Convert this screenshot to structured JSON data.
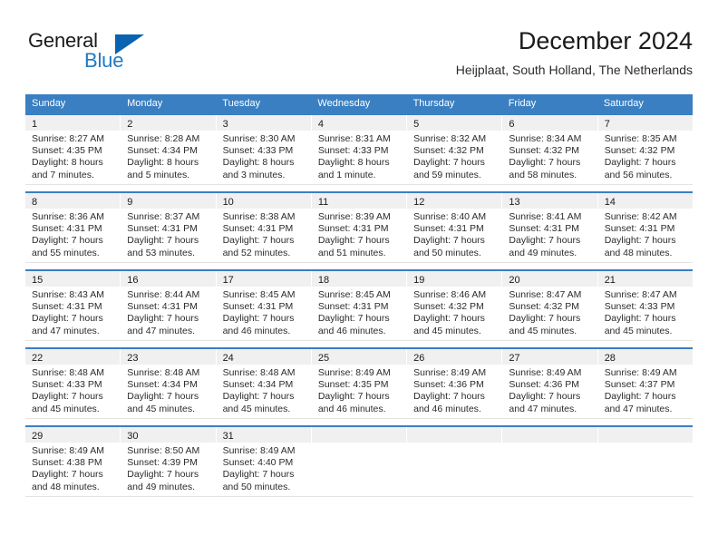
{
  "brand": {
    "name_part1": "General",
    "name_part2": "Blue",
    "triangle_color": "#0a63b0",
    "blue_text_color": "#1f7ac4"
  },
  "header": {
    "title": "December 2024",
    "subtitle": "Heijplaat, South Holland, The Netherlands"
  },
  "theme": {
    "header_blue": "#3a7fc1",
    "daynum_band": "#f0f0f0",
    "cell_text": "#2b2b2b"
  },
  "weekday_headers": [
    "Sunday",
    "Monday",
    "Tuesday",
    "Wednesday",
    "Thursday",
    "Friday",
    "Saturday"
  ],
  "weeks": [
    {
      "days": [
        {
          "num": "1",
          "sunrise": "Sunrise: 8:27 AM",
          "sunset": "Sunset: 4:35 PM",
          "daylight1": "Daylight: 8 hours",
          "daylight2": "and 7 minutes."
        },
        {
          "num": "2",
          "sunrise": "Sunrise: 8:28 AM",
          "sunset": "Sunset: 4:34 PM",
          "daylight1": "Daylight: 8 hours",
          "daylight2": "and 5 minutes."
        },
        {
          "num": "3",
          "sunrise": "Sunrise: 8:30 AM",
          "sunset": "Sunset: 4:33 PM",
          "daylight1": "Daylight: 8 hours",
          "daylight2": "and 3 minutes."
        },
        {
          "num": "4",
          "sunrise": "Sunrise: 8:31 AM",
          "sunset": "Sunset: 4:33 PM",
          "daylight1": "Daylight: 8 hours",
          "daylight2": "and 1 minute."
        },
        {
          "num": "5",
          "sunrise": "Sunrise: 8:32 AM",
          "sunset": "Sunset: 4:32 PM",
          "daylight1": "Daylight: 7 hours",
          "daylight2": "and 59 minutes."
        },
        {
          "num": "6",
          "sunrise": "Sunrise: 8:34 AM",
          "sunset": "Sunset: 4:32 PM",
          "daylight1": "Daylight: 7 hours",
          "daylight2": "and 58 minutes."
        },
        {
          "num": "7",
          "sunrise": "Sunrise: 8:35 AM",
          "sunset": "Sunset: 4:32 PM",
          "daylight1": "Daylight: 7 hours",
          "daylight2": "and 56 minutes."
        }
      ]
    },
    {
      "days": [
        {
          "num": "8",
          "sunrise": "Sunrise: 8:36 AM",
          "sunset": "Sunset: 4:31 PM",
          "daylight1": "Daylight: 7 hours",
          "daylight2": "and 55 minutes."
        },
        {
          "num": "9",
          "sunrise": "Sunrise: 8:37 AM",
          "sunset": "Sunset: 4:31 PM",
          "daylight1": "Daylight: 7 hours",
          "daylight2": "and 53 minutes."
        },
        {
          "num": "10",
          "sunrise": "Sunrise: 8:38 AM",
          "sunset": "Sunset: 4:31 PM",
          "daylight1": "Daylight: 7 hours",
          "daylight2": "and 52 minutes."
        },
        {
          "num": "11",
          "sunrise": "Sunrise: 8:39 AM",
          "sunset": "Sunset: 4:31 PM",
          "daylight1": "Daylight: 7 hours",
          "daylight2": "and 51 minutes."
        },
        {
          "num": "12",
          "sunrise": "Sunrise: 8:40 AM",
          "sunset": "Sunset: 4:31 PM",
          "daylight1": "Daylight: 7 hours",
          "daylight2": "and 50 minutes."
        },
        {
          "num": "13",
          "sunrise": "Sunrise: 8:41 AM",
          "sunset": "Sunset: 4:31 PM",
          "daylight1": "Daylight: 7 hours",
          "daylight2": "and 49 minutes."
        },
        {
          "num": "14",
          "sunrise": "Sunrise: 8:42 AM",
          "sunset": "Sunset: 4:31 PM",
          "daylight1": "Daylight: 7 hours",
          "daylight2": "and 48 minutes."
        }
      ]
    },
    {
      "days": [
        {
          "num": "15",
          "sunrise": "Sunrise: 8:43 AM",
          "sunset": "Sunset: 4:31 PM",
          "daylight1": "Daylight: 7 hours",
          "daylight2": "and 47 minutes."
        },
        {
          "num": "16",
          "sunrise": "Sunrise: 8:44 AM",
          "sunset": "Sunset: 4:31 PM",
          "daylight1": "Daylight: 7 hours",
          "daylight2": "and 47 minutes."
        },
        {
          "num": "17",
          "sunrise": "Sunrise: 8:45 AM",
          "sunset": "Sunset: 4:31 PM",
          "daylight1": "Daylight: 7 hours",
          "daylight2": "and 46 minutes."
        },
        {
          "num": "18",
          "sunrise": "Sunrise: 8:45 AM",
          "sunset": "Sunset: 4:31 PM",
          "daylight1": "Daylight: 7 hours",
          "daylight2": "and 46 minutes."
        },
        {
          "num": "19",
          "sunrise": "Sunrise: 8:46 AM",
          "sunset": "Sunset: 4:32 PM",
          "daylight1": "Daylight: 7 hours",
          "daylight2": "and 45 minutes."
        },
        {
          "num": "20",
          "sunrise": "Sunrise: 8:47 AM",
          "sunset": "Sunset: 4:32 PM",
          "daylight1": "Daylight: 7 hours",
          "daylight2": "and 45 minutes."
        },
        {
          "num": "21",
          "sunrise": "Sunrise: 8:47 AM",
          "sunset": "Sunset: 4:33 PM",
          "daylight1": "Daylight: 7 hours",
          "daylight2": "and 45 minutes."
        }
      ]
    },
    {
      "days": [
        {
          "num": "22",
          "sunrise": "Sunrise: 8:48 AM",
          "sunset": "Sunset: 4:33 PM",
          "daylight1": "Daylight: 7 hours",
          "daylight2": "and 45 minutes."
        },
        {
          "num": "23",
          "sunrise": "Sunrise: 8:48 AM",
          "sunset": "Sunset: 4:34 PM",
          "daylight1": "Daylight: 7 hours",
          "daylight2": "and 45 minutes."
        },
        {
          "num": "24",
          "sunrise": "Sunrise: 8:48 AM",
          "sunset": "Sunset: 4:34 PM",
          "daylight1": "Daylight: 7 hours",
          "daylight2": "and 45 minutes."
        },
        {
          "num": "25",
          "sunrise": "Sunrise: 8:49 AM",
          "sunset": "Sunset: 4:35 PM",
          "daylight1": "Daylight: 7 hours",
          "daylight2": "and 46 minutes."
        },
        {
          "num": "26",
          "sunrise": "Sunrise: 8:49 AM",
          "sunset": "Sunset: 4:36 PM",
          "daylight1": "Daylight: 7 hours",
          "daylight2": "and 46 minutes."
        },
        {
          "num": "27",
          "sunrise": "Sunrise: 8:49 AM",
          "sunset": "Sunset: 4:36 PM",
          "daylight1": "Daylight: 7 hours",
          "daylight2": "and 47 minutes."
        },
        {
          "num": "28",
          "sunrise": "Sunrise: 8:49 AM",
          "sunset": "Sunset: 4:37 PM",
          "daylight1": "Daylight: 7 hours",
          "daylight2": "and 47 minutes."
        }
      ]
    },
    {
      "days": [
        {
          "num": "29",
          "sunrise": "Sunrise: 8:49 AM",
          "sunset": "Sunset: 4:38 PM",
          "daylight1": "Daylight: 7 hours",
          "daylight2": "and 48 minutes."
        },
        {
          "num": "30",
          "sunrise": "Sunrise: 8:50 AM",
          "sunset": "Sunset: 4:39 PM",
          "daylight1": "Daylight: 7 hours",
          "daylight2": "and 49 minutes."
        },
        {
          "num": "31",
          "sunrise": "Sunrise: 8:49 AM",
          "sunset": "Sunset: 4:40 PM",
          "daylight1": "Daylight: 7 hours",
          "daylight2": "and 50 minutes."
        },
        {
          "num": "",
          "sunrise": "",
          "sunset": "",
          "daylight1": "",
          "daylight2": ""
        },
        {
          "num": "",
          "sunrise": "",
          "sunset": "",
          "daylight1": "",
          "daylight2": ""
        },
        {
          "num": "",
          "sunrise": "",
          "sunset": "",
          "daylight1": "",
          "daylight2": ""
        },
        {
          "num": "",
          "sunrise": "",
          "sunset": "",
          "daylight1": "",
          "daylight2": ""
        }
      ]
    }
  ]
}
